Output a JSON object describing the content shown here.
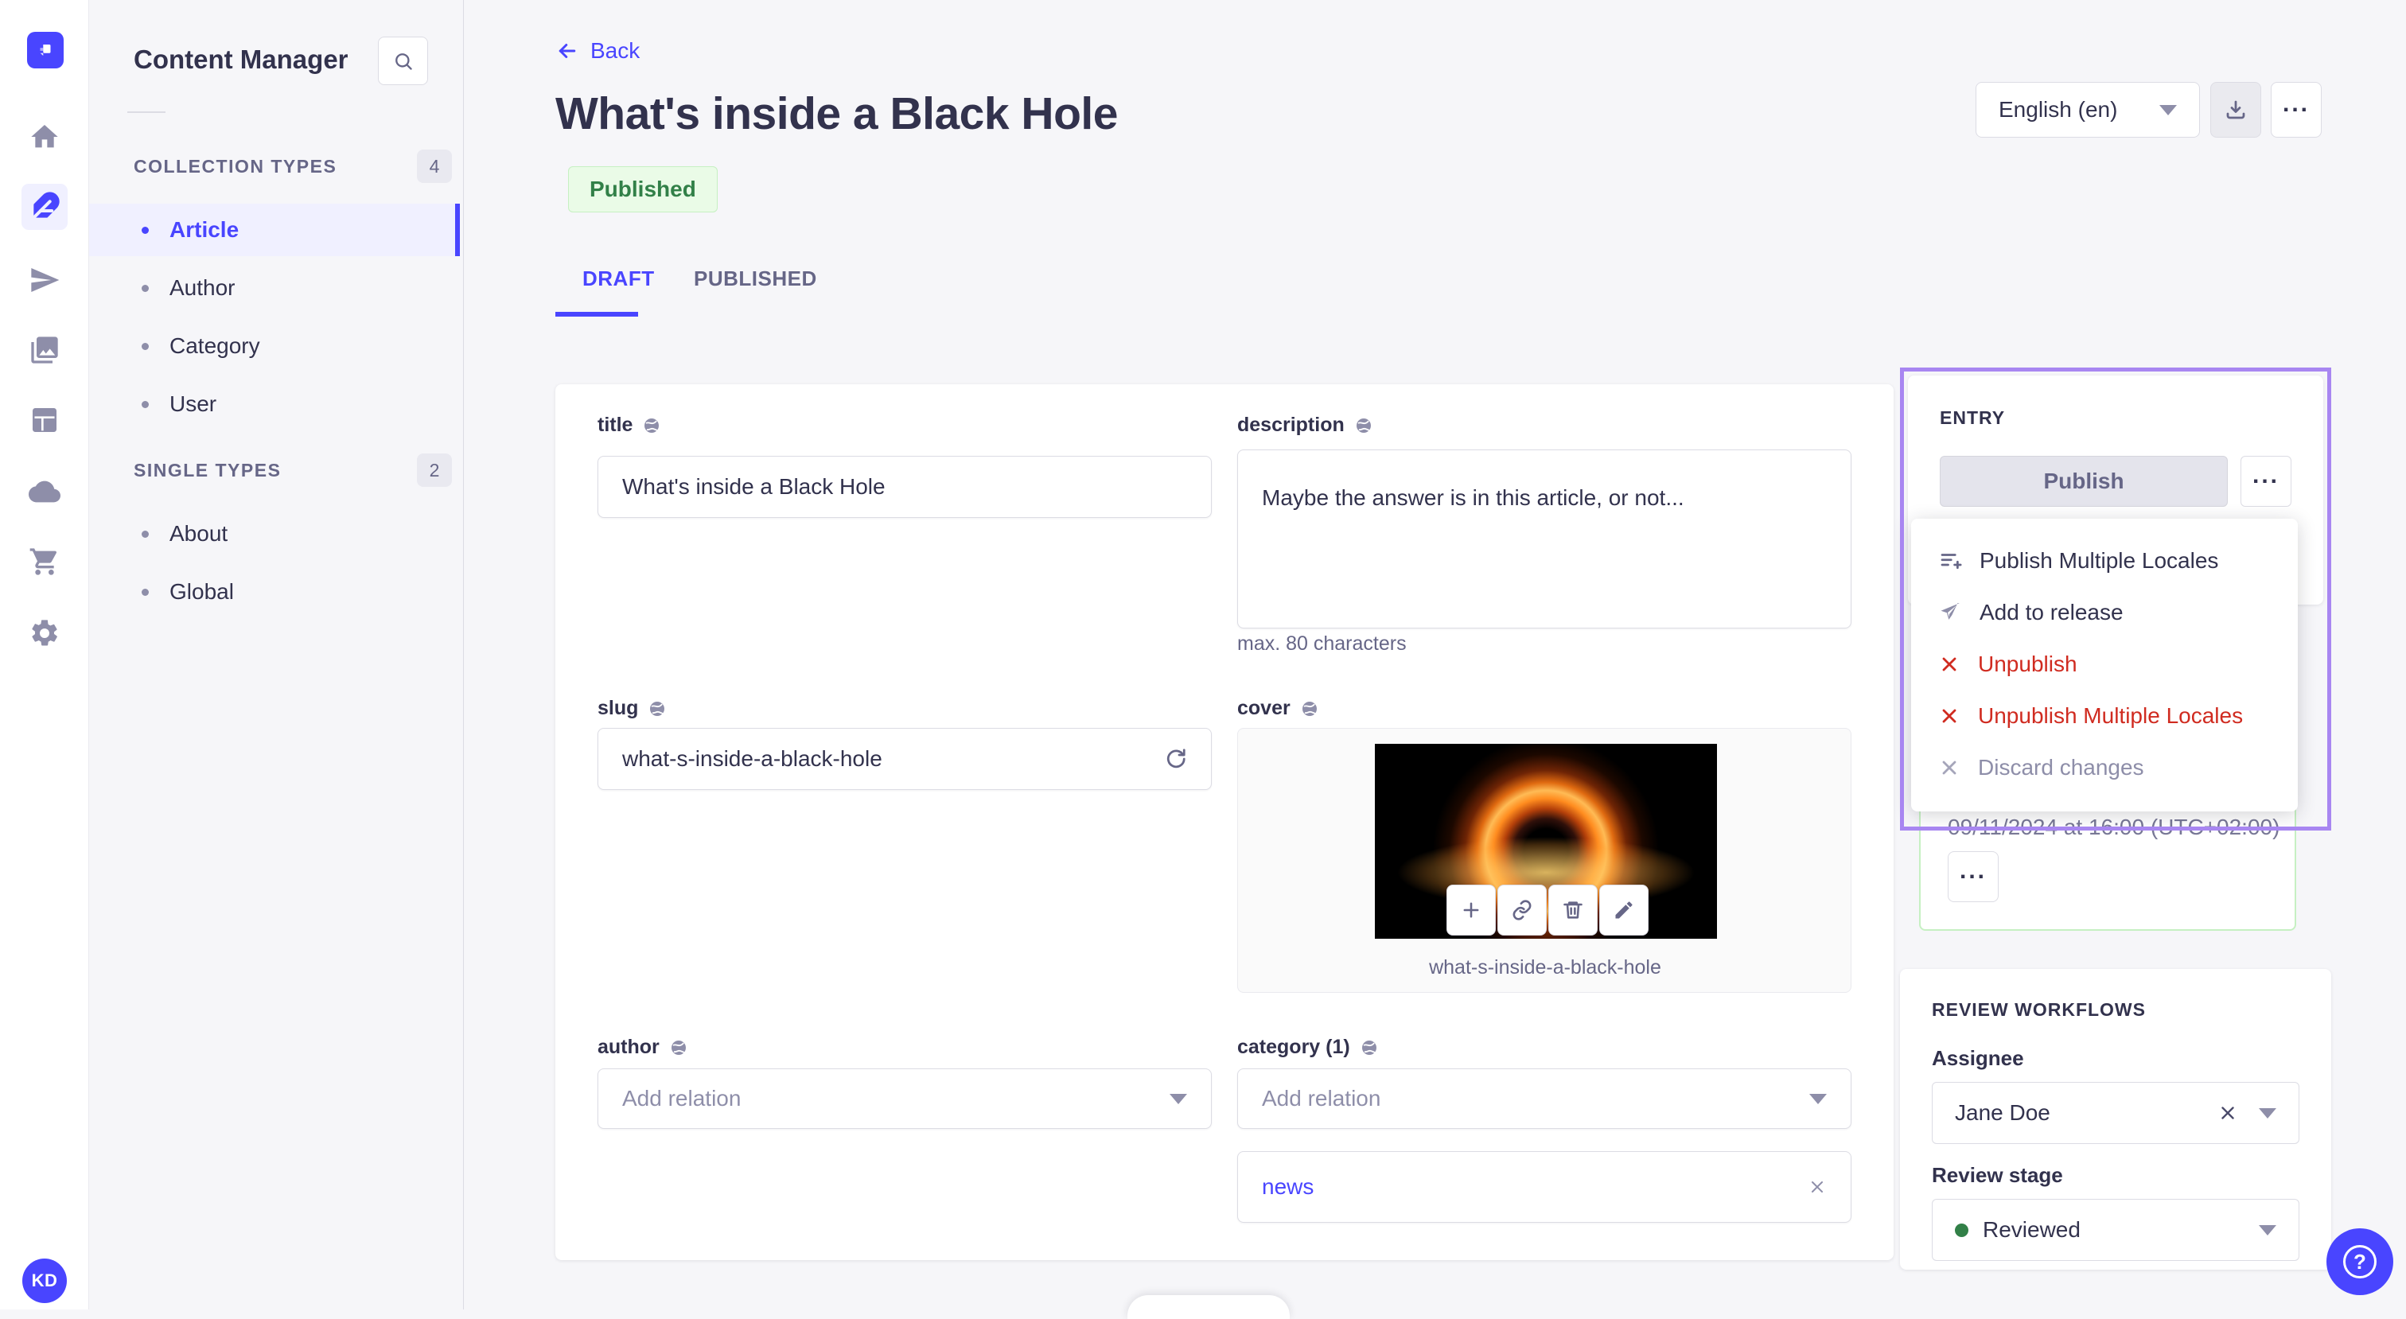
{
  "subnav": {
    "title": "Content Manager",
    "sections": [
      {
        "label": "COLLECTION TYPES",
        "count": "4",
        "items": [
          {
            "label": "Article"
          },
          {
            "label": "Author"
          },
          {
            "label": "Category"
          },
          {
            "label": "User"
          }
        ]
      },
      {
        "label": "SINGLE TYPES",
        "count": "2",
        "items": [
          {
            "label": "About"
          },
          {
            "label": "Global"
          }
        ]
      }
    ]
  },
  "header": {
    "back_label": "Back",
    "title": "What's inside a Black Hole",
    "status_badge": "Published",
    "locale_selector": "English (en)"
  },
  "tabs": {
    "draft": "DRAFT",
    "published": "PUBLISHED"
  },
  "form": {
    "title": {
      "label": "title",
      "value": "What's inside a Black Hole"
    },
    "description": {
      "label": "description",
      "value": "Maybe the answer is in this article, or not...",
      "hint": "max. 80 characters"
    },
    "slug": {
      "label": "slug",
      "value": "what-s-inside-a-black-hole"
    },
    "cover": {
      "label": "cover",
      "caption": "what-s-inside-a-black-hole"
    },
    "author": {
      "label": "author",
      "placeholder": "Add relation"
    },
    "category": {
      "label": "category (1)",
      "placeholder": "Add relation",
      "selected_relation": "news"
    }
  },
  "entry_panel": {
    "heading": "ENTRY",
    "publish_button": "Publish",
    "menu": [
      {
        "label": "Publish Multiple Locales"
      },
      {
        "label": "Add to release"
      },
      {
        "label": "Unpublish"
      },
      {
        "label": "Unpublish Multiple Locales"
      },
      {
        "label": "Discard changes"
      }
    ],
    "scheduled_date": "09/11/2024 at 16:00 (UTC+02:00)"
  },
  "review": {
    "heading": "REVIEW WORKFLOWS",
    "assignee_label": "Assignee",
    "assignee_value": "Jane Doe",
    "stage_label": "Review stage",
    "stage_value": "Reviewed"
  },
  "user": {
    "initials": "KD"
  },
  "icons": [
    "strapi-logo",
    "home-icon",
    "feather-icon",
    "paper-plane-icon",
    "media-icon",
    "layout-icon",
    "cloud-icon",
    "cart-icon",
    "gear-icon",
    "search-icon",
    "back-arrow-icon",
    "chevron-down-icon",
    "download-icon",
    "more-icon",
    "globe-icon",
    "refresh-icon",
    "plus-icon",
    "link-icon",
    "trash-icon",
    "pencil-icon",
    "close-icon",
    "list-plus-icon",
    "question-icon"
  ],
  "colors": {
    "primary": "#4945ff",
    "purple_outline": "#a886f1",
    "success_text": "#328048",
    "success_bg": "#eafbe7",
    "success_border": "#c6f0c2",
    "danger": "#d02b20",
    "neutral_text": "#32324d",
    "muted_text": "#666687"
  }
}
